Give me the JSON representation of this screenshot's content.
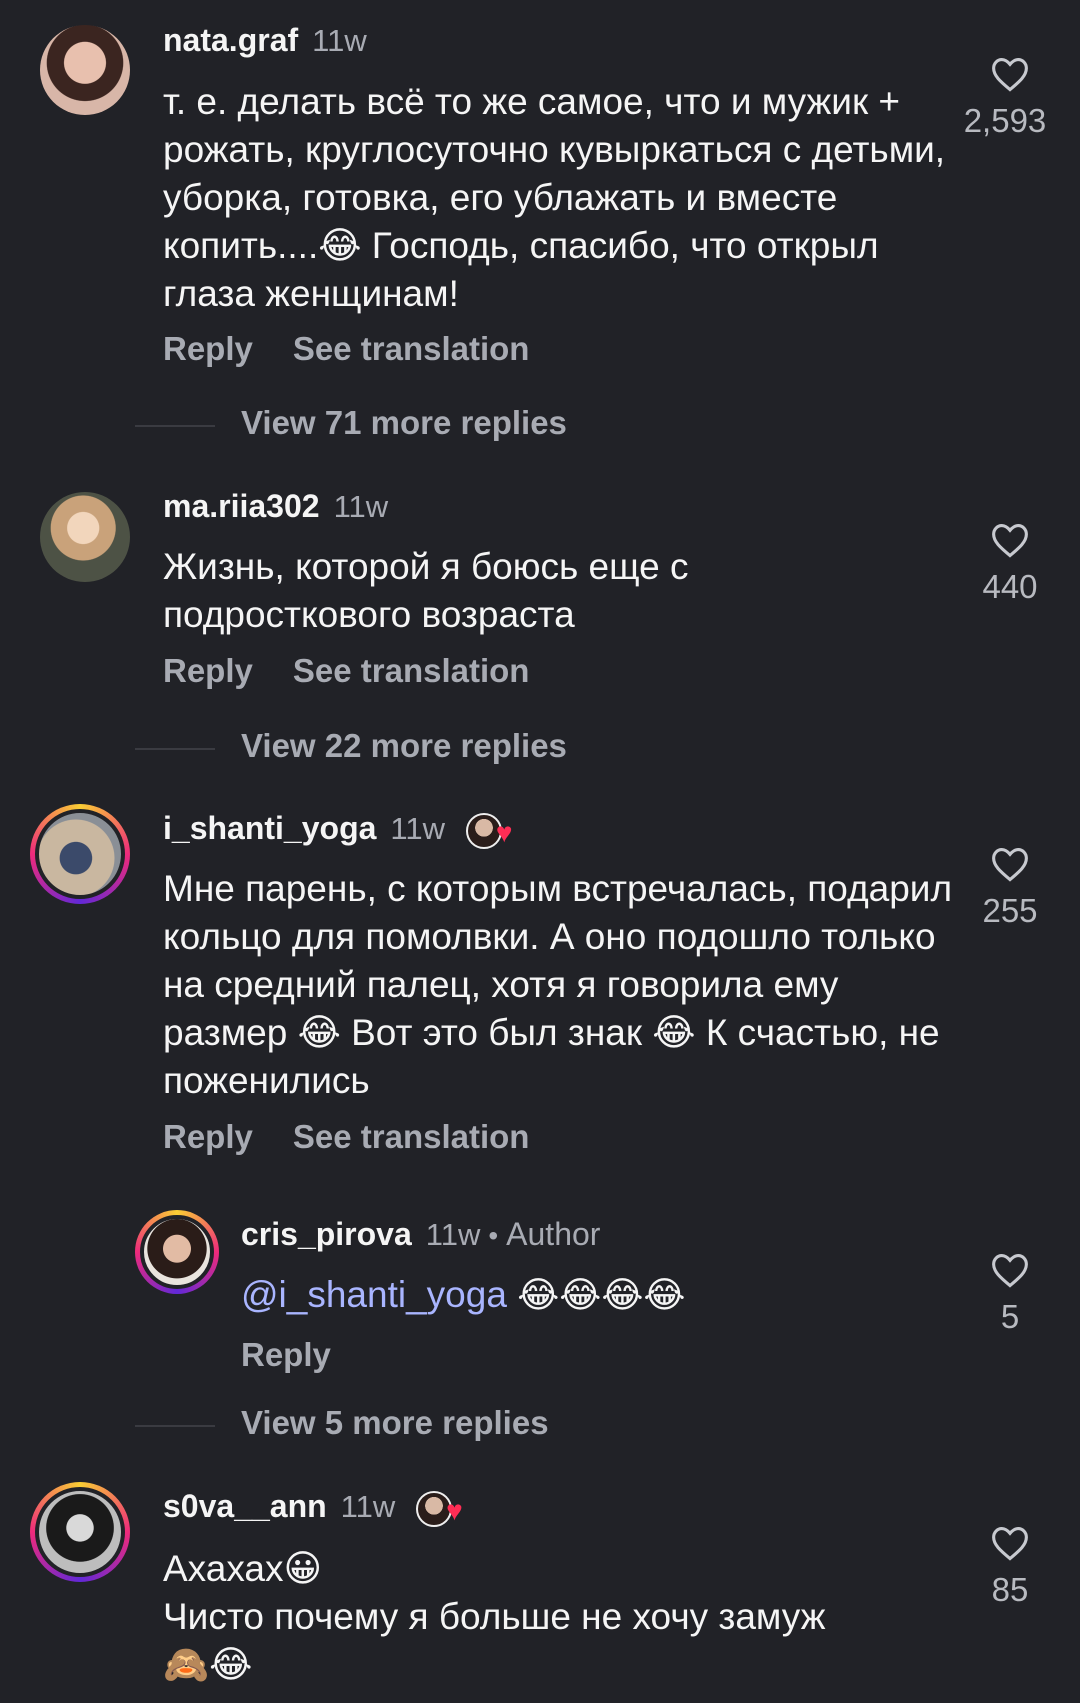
{
  "comments": [
    {
      "username": "nata.graf",
      "time": "11w",
      "text": "т. е. делать всё то же самое, что и мужик + рожать, круглосуточно кувыркаться с детьми, уборка, готовка, его ублажать  и вместе копить....😂 Господь, спасибо, что открыл глаза женщинам!",
      "reply": "Reply",
      "translate": "See translation",
      "likes": "2,593",
      "more_replies": "View 71 more replies"
    },
    {
      "username": "ma.riia302",
      "time": "11w",
      "text": "Жизнь, которой я боюсь еще с подросткового возраста",
      "reply": "Reply",
      "translate": "See translation",
      "likes": "440",
      "more_replies": "View 22 more replies"
    },
    {
      "username": "i_shanti_yoga",
      "time": "11w",
      "text": "Мне парень, с которым встречалась, подарил кольцо для помолвки. А оно подошло только на средний палец, хотя я говорила ему размер 😂 Вот это был знак 😂 К счастью, не поженились",
      "reply": "Reply",
      "translate": "See translation",
      "likes": "255"
    },
    {
      "username": "cris_pirova",
      "time": "11w",
      "author_label": "Author",
      "mention": "@i_shanti_yoga",
      "emojis": "😂😂😂😂",
      "reply": "Reply",
      "likes": "5",
      "more_replies": "View 5 more replies"
    },
    {
      "username": "s0va__ann",
      "time": "11w",
      "text_line1": "Ахахах😀",
      "text_line2": "Чисто почему я больше не хочу замуж",
      "text_line3": "🙈😂",
      "likes": "85"
    }
  ],
  "icons": {
    "like": "heart-outline-icon",
    "liked_by_author": "author-liked-heart-icon"
  },
  "colors": {
    "background": "#212227",
    "mention": "#a9b5ff",
    "heart": "#ff2d55"
  }
}
